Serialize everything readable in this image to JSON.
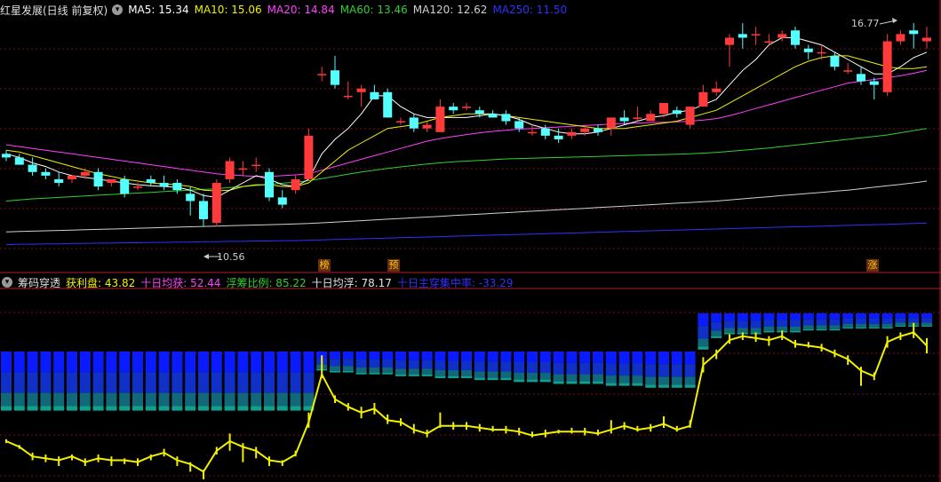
{
  "main_header": {
    "title": "红星发展(日线 前复权)",
    "ma5": "MA5: 15.34",
    "ma10": "MA10: 15.06",
    "ma20": "MA20: 14.84",
    "ma60": "MA60: 13.46",
    "ma120": "MA120: 12.62",
    "ma250": "MA250: 11.50"
  },
  "sub_header": {
    "title": "筹码穿透",
    "profit": "获利盘: 43.82",
    "avg10": "十日均获: 52.44",
    "float_ratio": "浮筹比例: 85.22",
    "avg_float": "十日均浮: 78.17",
    "concentration": "十日主穿集中率: -33.29"
  },
  "annotations": {
    "high_price": "16.77",
    "low_price": "10.56",
    "badge_1": "榜",
    "badge_2": "预",
    "badge_3": "涨"
  },
  "colors": {
    "up": "#ff3a3a",
    "down": "#54ffff",
    "ma5": "#ffffff",
    "ma10": "#f0f000",
    "ma20": "#ff40ff",
    "ma60": "#30d030",
    "ma120": "#d0d0d0",
    "ma250": "#3030ff",
    "profit_line": "#f0f000"
  },
  "chart_data": {
    "type": "candlestick",
    "candles": [
      [
        13.3,
        13.4,
        13.1,
        13.2
      ],
      [
        13.2,
        13.3,
        13.0,
        13.0
      ],
      [
        13.0,
        13.2,
        12.7,
        12.8
      ],
      [
        12.8,
        12.9,
        12.6,
        12.7
      ],
      [
        12.6,
        12.8,
        12.4,
        12.5
      ],
      [
        12.6,
        12.7,
        12.5,
        12.7
      ],
      [
        12.7,
        12.9,
        12.6,
        12.8
      ],
      [
        12.8,
        12.9,
        12.3,
        12.4
      ],
      [
        12.5,
        12.6,
        12.4,
        12.6
      ],
      [
        12.6,
        12.7,
        12.1,
        12.2
      ],
      [
        12.4,
        12.5,
        12.3,
        12.4
      ],
      [
        12.6,
        12.7,
        12.4,
        12.5
      ],
      [
        12.5,
        12.7,
        12.3,
        12.4
      ],
      [
        12.5,
        12.6,
        12.2,
        12.3
      ],
      [
        12.2,
        12.4,
        11.6,
        12.0
      ],
      [
        12.0,
        12.2,
        11.3,
        11.5
      ],
      [
        11.4,
        12.6,
        11.3,
        12.5
      ],
      [
        12.6,
        13.2,
        12.5,
        13.1
      ],
      [
        12.9,
        13.1,
        12.7,
        12.9
      ],
      [
        13.0,
        13.2,
        12.8,
        13.0
      ],
      [
        12.8,
        12.9,
        12.0,
        12.1
      ],
      [
        12.1,
        12.3,
        11.8,
        11.9
      ],
      [
        12.3,
        12.7,
        12.2,
        12.6
      ],
      [
        12.6,
        14.0,
        12.6,
        13.8
      ],
      [
        15.5,
        15.7,
        15.3,
        15.5
      ],
      [
        15.6,
        16.0,
        15.1,
        15.2
      ],
      [
        14.9,
        15.3,
        14.8,
        14.9
      ],
      [
        15.0,
        15.2,
        14.6,
        15.1
      ],
      [
        15.0,
        15.2,
        14.8,
        14.8
      ],
      [
        15.0,
        15.1,
        14.3,
        14.3
      ],
      [
        14.2,
        14.3,
        14.1,
        14.2
      ],
      [
        14.3,
        14.4,
        13.9,
        14.0
      ],
      [
        14.0,
        14.2,
        13.9,
        14.1
      ],
      [
        13.9,
        14.8,
        13.9,
        14.6
      ],
      [
        14.6,
        14.7,
        14.4,
        14.5
      ],
      [
        14.6,
        14.7,
        14.5,
        14.6
      ],
      [
        14.5,
        14.6,
        14.3,
        14.4
      ],
      [
        14.4,
        14.5,
        14.3,
        14.3
      ],
      [
        14.4,
        14.5,
        14.1,
        14.2
      ],
      [
        14.2,
        14.3,
        13.9,
        14.0
      ],
      [
        13.9,
        14.1,
        13.8,
        13.9
      ],
      [
        14.0,
        14.1,
        13.7,
        13.8
      ],
      [
        13.8,
        14.0,
        13.6,
        13.7
      ],
      [
        13.8,
        14.0,
        13.7,
        13.9
      ],
      [
        13.9,
        14.1,
        13.8,
        14.0
      ],
      [
        14.0,
        14.1,
        13.8,
        13.9
      ],
      [
        14.0,
        14.3,
        13.8,
        14.3
      ],
      [
        14.3,
        14.5,
        14.1,
        14.2
      ],
      [
        14.3,
        14.6,
        14.2,
        14.3
      ],
      [
        14.2,
        14.5,
        14.2,
        14.4
      ],
      [
        14.4,
        14.7,
        14.3,
        14.7
      ],
      [
        14.5,
        14.6,
        14.3,
        14.4
      ],
      [
        14.1,
        14.6,
        14.0,
        14.6
      ],
      [
        14.6,
        15.2,
        14.6,
        15.0
      ],
      [
        15.0,
        15.3,
        14.9,
        15.1
      ],
      [
        16.3,
        16.6,
        15.7,
        16.5
      ],
      [
        16.6,
        16.9,
        16.2,
        16.5
      ],
      [
        16.6,
        16.8,
        16.3,
        16.6
      ],
      [
        16.4,
        16.6,
        16.3,
        16.4
      ],
      [
        16.5,
        16.7,
        16.4,
        16.6
      ],
      [
        16.7,
        16.8,
        16.2,
        16.3
      ],
      [
        16.2,
        16.3,
        15.9,
        16.1
      ],
      [
        16.1,
        16.3,
        15.9,
        16.1
      ],
      [
        16.0,
        16.1,
        15.6,
        15.7
      ],
      [
        15.6,
        15.8,
        15.5,
        15.6
      ],
      [
        15.5,
        15.7,
        15.2,
        15.3
      ],
      [
        15.3,
        15.4,
        14.8,
        15.2
      ],
      [
        15.0,
        16.6,
        14.9,
        16.4
      ],
      [
        16.4,
        16.7,
        16.3,
        16.6
      ],
      [
        16.7,
        16.9,
        16.2,
        16.6
      ],
      [
        16.4,
        16.8,
        16.2,
        16.5
      ]
    ],
    "ma5": [
      13.3,
      13.2,
      13.05,
      12.95,
      12.8,
      12.7,
      12.65,
      12.6,
      12.55,
      12.5,
      12.45,
      12.42,
      12.4,
      12.38,
      12.3,
      12.15,
      12.1,
      12.3,
      12.5,
      12.7,
      12.6,
      12.45,
      12.4,
      12.6,
      13.3,
      13.7,
      14.0,
      14.4,
      14.9,
      14.9,
      14.6,
      14.4,
      14.3,
      14.3,
      14.3,
      14.3,
      14.35,
      14.4,
      14.35,
      14.25,
      14.1,
      14.0,
      13.9,
      13.85,
      13.85,
      13.9,
      14.0,
      14.1,
      14.2,
      14.3,
      14.35,
      14.45,
      14.5,
      14.65,
      14.8,
      15.2,
      15.6,
      15.9,
      16.3,
      16.5,
      16.5,
      16.4,
      16.3,
      16.1,
      15.9,
      15.7,
      15.5,
      15.5,
      15.7,
      15.95,
      16.1
    ],
    "ma10": [
      13.4,
      13.35,
      13.25,
      13.15,
      13.05,
      12.95,
      12.85,
      12.75,
      12.68,
      12.6,
      12.55,
      12.5,
      12.47,
      12.45,
      12.4,
      12.3,
      12.28,
      12.3,
      12.4,
      12.45,
      12.45,
      12.4,
      12.4,
      12.5,
      12.8,
      13.1,
      13.4,
      13.6,
      13.8,
      14.0,
      14.05,
      14.1,
      14.2,
      14.3,
      14.35,
      14.4,
      14.4,
      14.4,
      14.35,
      14.3,
      14.25,
      14.2,
      14.15,
      14.1,
      14.05,
      14.0,
      14.0,
      14.0,
      14.05,
      14.1,
      14.15,
      14.2,
      14.3,
      14.4,
      14.5,
      14.7,
      14.9,
      15.1,
      15.3,
      15.5,
      15.7,
      15.85,
      15.95,
      16.0,
      16.0,
      15.9,
      15.8,
      15.7,
      15.65,
      15.65,
      15.7
    ],
    "ma20": [
      13.55,
      13.5,
      13.45,
      13.4,
      13.35,
      13.3,
      13.25,
      13.2,
      13.15,
      13.1,
      13.05,
      13.0,
      12.95,
      12.9,
      12.85,
      12.8,
      12.75,
      12.72,
      12.7,
      12.68,
      12.68,
      12.7,
      12.72,
      12.75,
      12.85,
      12.95,
      13.05,
      13.15,
      13.25,
      13.35,
      13.45,
      13.55,
      13.65,
      13.72,
      13.78,
      13.83,
      13.88,
      13.92,
      13.95,
      13.98,
      14.0,
      14.02,
      14.04,
      14.06,
      14.08,
      14.1,
      14.12,
      14.14,
      14.15,
      14.16,
      14.17,
      14.18,
      14.2,
      14.23,
      14.27,
      14.35,
      14.45,
      14.55,
      14.65,
      14.75,
      14.85,
      14.95,
      15.05,
      15.15,
      15.25,
      15.3,
      15.35,
      15.4,
      15.45,
      15.52,
      15.6
    ],
    "ma60": [
      12.0,
      12.03,
      12.06,
      12.08,
      12.1,
      12.12,
      12.14,
      12.16,
      12.18,
      12.2,
      12.22,
      12.24,
      12.26,
      12.28,
      12.3,
      12.32,
      12.34,
      12.37,
      12.4,
      12.43,
      12.46,
      12.49,
      12.52,
      12.56,
      12.62,
      12.68,
      12.74,
      12.8,
      12.85,
      12.9,
      12.94,
      12.98,
      13.02,
      13.05,
      13.08,
      13.1,
      13.12,
      13.14,
      13.16,
      13.17,
      13.18,
      13.19,
      13.2,
      13.21,
      13.22,
      13.23,
      13.24,
      13.25,
      13.26,
      13.27,
      13.28,
      13.29,
      13.3,
      13.32,
      13.34,
      13.37,
      13.4,
      13.43,
      13.46,
      13.5,
      13.54,
      13.58,
      13.62,
      13.66,
      13.7,
      13.74,
      13.78,
      13.82,
      13.88,
      13.94,
      14.0
    ],
    "ma120": [
      11.15,
      11.16,
      11.17,
      11.18,
      11.19,
      11.2,
      11.21,
      11.22,
      11.23,
      11.24,
      11.25,
      11.26,
      11.27,
      11.28,
      11.29,
      11.3,
      11.31,
      11.32,
      11.33,
      11.34,
      11.35,
      11.36,
      11.37,
      11.38,
      11.4,
      11.42,
      11.44,
      11.46,
      11.48,
      11.5,
      11.52,
      11.54,
      11.56,
      11.58,
      11.6,
      11.62,
      11.64,
      11.66,
      11.68,
      11.7,
      11.72,
      11.74,
      11.76,
      11.78,
      11.8,
      11.82,
      11.84,
      11.86,
      11.88,
      11.9,
      11.92,
      11.94,
      11.96,
      11.98,
      12.0,
      12.03,
      12.06,
      12.09,
      12.12,
      12.15,
      12.18,
      12.21,
      12.24,
      12.27,
      12.3,
      12.34,
      12.38,
      12.42,
      12.46,
      12.5,
      12.55
    ],
    "ma250": [
      10.8,
      10.81,
      10.81,
      10.82,
      10.82,
      10.83,
      10.83,
      10.84,
      10.84,
      10.85,
      10.85,
      10.86,
      10.86,
      10.87,
      10.87,
      10.88,
      10.88,
      10.89,
      10.89,
      10.9,
      10.9,
      10.91,
      10.91,
      10.92,
      10.93,
      10.94,
      10.95,
      10.96,
      10.97,
      10.98,
      10.99,
      11.0,
      11.01,
      11.02,
      11.03,
      11.04,
      11.05,
      11.06,
      11.07,
      11.08,
      11.09,
      11.1,
      11.11,
      11.12,
      11.13,
      11.14,
      11.15,
      11.16,
      11.17,
      11.18,
      11.19,
      11.2,
      11.21,
      11.22,
      11.23,
      11.24,
      11.25,
      11.26,
      11.27,
      11.28,
      11.29,
      11.3,
      11.31,
      11.32,
      11.33,
      11.34,
      11.35,
      11.36,
      11.37,
      11.38,
      11.39
    ],
    "profit": [
      20,
      17,
      12,
      11,
      10,
      12,
      9,
      11,
      10,
      10,
      9,
      12,
      14,
      10,
      8,
      4,
      15,
      20,
      17,
      15,
      10,
      9,
      13,
      30,
      55,
      42,
      38,
      35,
      37,
      31,
      30,
      26,
      24,
      28,
      28,
      28,
      27,
      26,
      26,
      25,
      23,
      24,
      25,
      25,
      25,
      24,
      26,
      28,
      26,
      27,
      29,
      26,
      28,
      60,
      66,
      73,
      75,
      74,
      73,
      75,
      71,
      70,
      69,
      66,
      63,
      57,
      54,
      72,
      75,
      77,
      70
    ],
    "profit_high": [
      21,
      18,
      14,
      13,
      12,
      13,
      11,
      13,
      12,
      11,
      11,
      13,
      16,
      12,
      9,
      5,
      17,
      24,
      19,
      17,
      12,
      10,
      15,
      35,
      65,
      44,
      40,
      38,
      40,
      34,
      32,
      29,
      26,
      35,
      30,
      30,
      29,
      28,
      28,
      27,
      25,
      26,
      26,
      27,
      27,
      26,
      31,
      30,
      28,
      29,
      33,
      28,
      31,
      64,
      68,
      76,
      77,
      77,
      75,
      78,
      73,
      72,
      71,
      68,
      65,
      59,
      56,
      75,
      77,
      82,
      74
    ],
    "profit_low": [
      19,
      16,
      10,
      9,
      7,
      10,
      7,
      9,
      7,
      8,
      7,
      10,
      12,
      7,
      4,
      0,
      13,
      15,
      9,
      11,
      7,
      7,
      12,
      27,
      53,
      40,
      36,
      32,
      34,
      29,
      28,
      24,
      22,
      27,
      26,
      26,
      25,
      25,
      24,
      23,
      22,
      22,
      24,
      24,
      23,
      23,
      24,
      26,
      25,
      25,
      27,
      25,
      27,
      56,
      63,
      71,
      73,
      72,
      70,
      73,
      69,
      69,
      67,
      64,
      60,
      49,
      52,
      69,
      73,
      74,
      66
    ],
    "chip_top": [
      67,
      67,
      67,
      67,
      67,
      67,
      67,
      67,
      67,
      67,
      67,
      67,
      67,
      67,
      67,
      67,
      67,
      67,
      67,
      67,
      67,
      67,
      67,
      67,
      67,
      67,
      67,
      67,
      67,
      67,
      67,
      67,
      67,
      67,
      67,
      67,
      67,
      67,
      67,
      67,
      67,
      67,
      67,
      67,
      67,
      67,
      67,
      67,
      67,
      67,
      67,
      67,
      67,
      87,
      87,
      87,
      87,
      87,
      87,
      87,
      87,
      87,
      87,
      87,
      87,
      87,
      87,
      87,
      87,
      87,
      87
    ],
    "chip_bot": [
      36,
      36,
      36,
      36,
      36,
      36,
      36,
      36,
      36,
      36,
      36,
      36,
      36,
      36,
      36,
      36,
      36,
      36,
      36,
      36,
      36,
      36,
      36,
      36,
      57,
      56,
      56,
      55,
      55,
      55,
      54,
      54,
      54,
      53,
      53,
      53,
      52,
      52,
      52,
      51,
      51,
      51,
      50,
      50,
      50,
      50,
      49,
      49,
      49,
      48,
      48,
      48,
      48,
      68,
      74,
      76,
      76,
      76,
      77,
      77,
      77,
      78,
      78,
      78,
      79,
      79,
      79,
      79,
      80,
      80,
      80
    ]
  }
}
